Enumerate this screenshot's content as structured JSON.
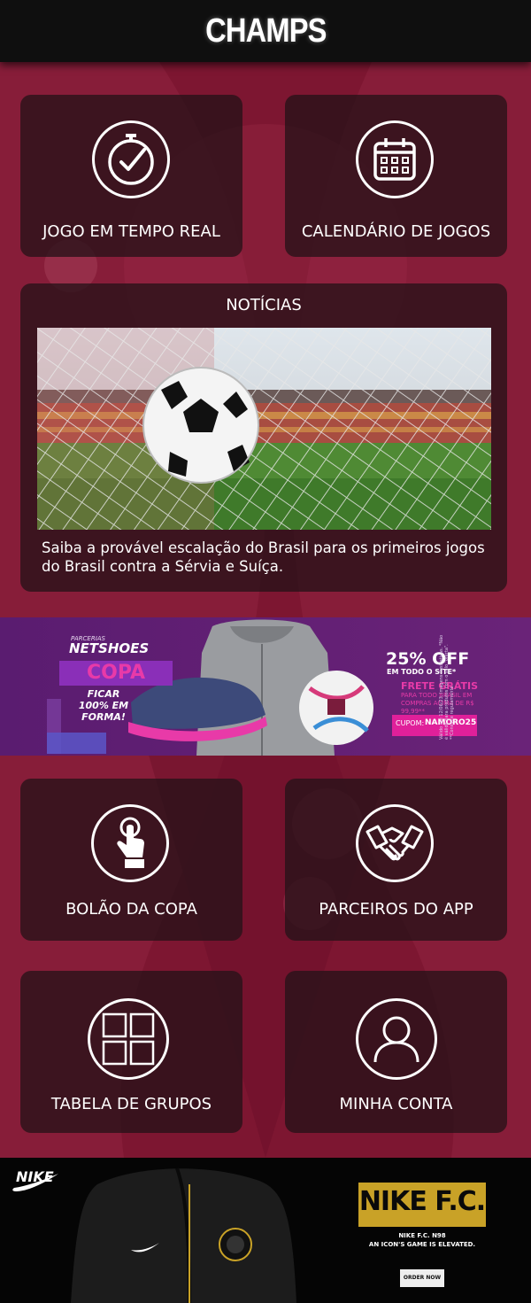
{
  "app": {
    "title": "CHAMPS"
  },
  "tiles": {
    "live": {
      "label": "JOGO EM TEMPO REAL",
      "icon": "stopwatch-check-icon"
    },
    "calendar": {
      "label": "CALENDÁRIO DE JOGOS",
      "icon": "calendar-icon"
    },
    "pool": {
      "label": "BOLÃO DA COPA",
      "icon": "hand-tap-icon"
    },
    "partners": {
      "label": "PARCEIROS DO APP",
      "icon": "handshake-icon"
    },
    "groups": {
      "label": "TABELA DE GRUPOS",
      "icon": "grid-icon"
    },
    "account": {
      "label": "MINHA CONTA",
      "icon": "user-icon"
    }
  },
  "news": {
    "title": "NOTÍCIAS",
    "headline": "Saiba a provável escalação do Brasil para os primeiros jogos do Brasil contra a Sérvia e Suíça."
  },
  "netshoes_ad": {
    "partner_label": "PARCERIAS",
    "brand": "NETSHOES",
    "campaign": "COPA",
    "tagline": "FICAR 100% EM FORMA!",
    "discount": "25% OFF",
    "discount_sub": "EM TODO O SITE*",
    "shipping": "FRETE GRÁTIS",
    "shipping_sub": "PARA TODO BRASIL EM COMPRAS ACIMA DE R$ 99,99**",
    "coupon_label": "CUPOM:",
    "coupon_code": "NAMORO25",
    "legal": "Válido até 12/06/23. Imagens ilustrativas. *Não é válido para produtos com o selo \"oferta\". **Consulte regulamento."
  },
  "nike_ad": {
    "brand": "NIKE",
    "logo_text": "NIKE F.C.",
    "line1": "NIKE F.C. N98",
    "line2": "AN ICON'S GAME IS ELEVATED.",
    "cta": "ORDER NOW"
  },
  "colors": {
    "background": "#7d1631",
    "card": "#26121a",
    "header": "#0f0f0f",
    "accent_pink": "#e0209a",
    "gold": "#c9a227"
  }
}
